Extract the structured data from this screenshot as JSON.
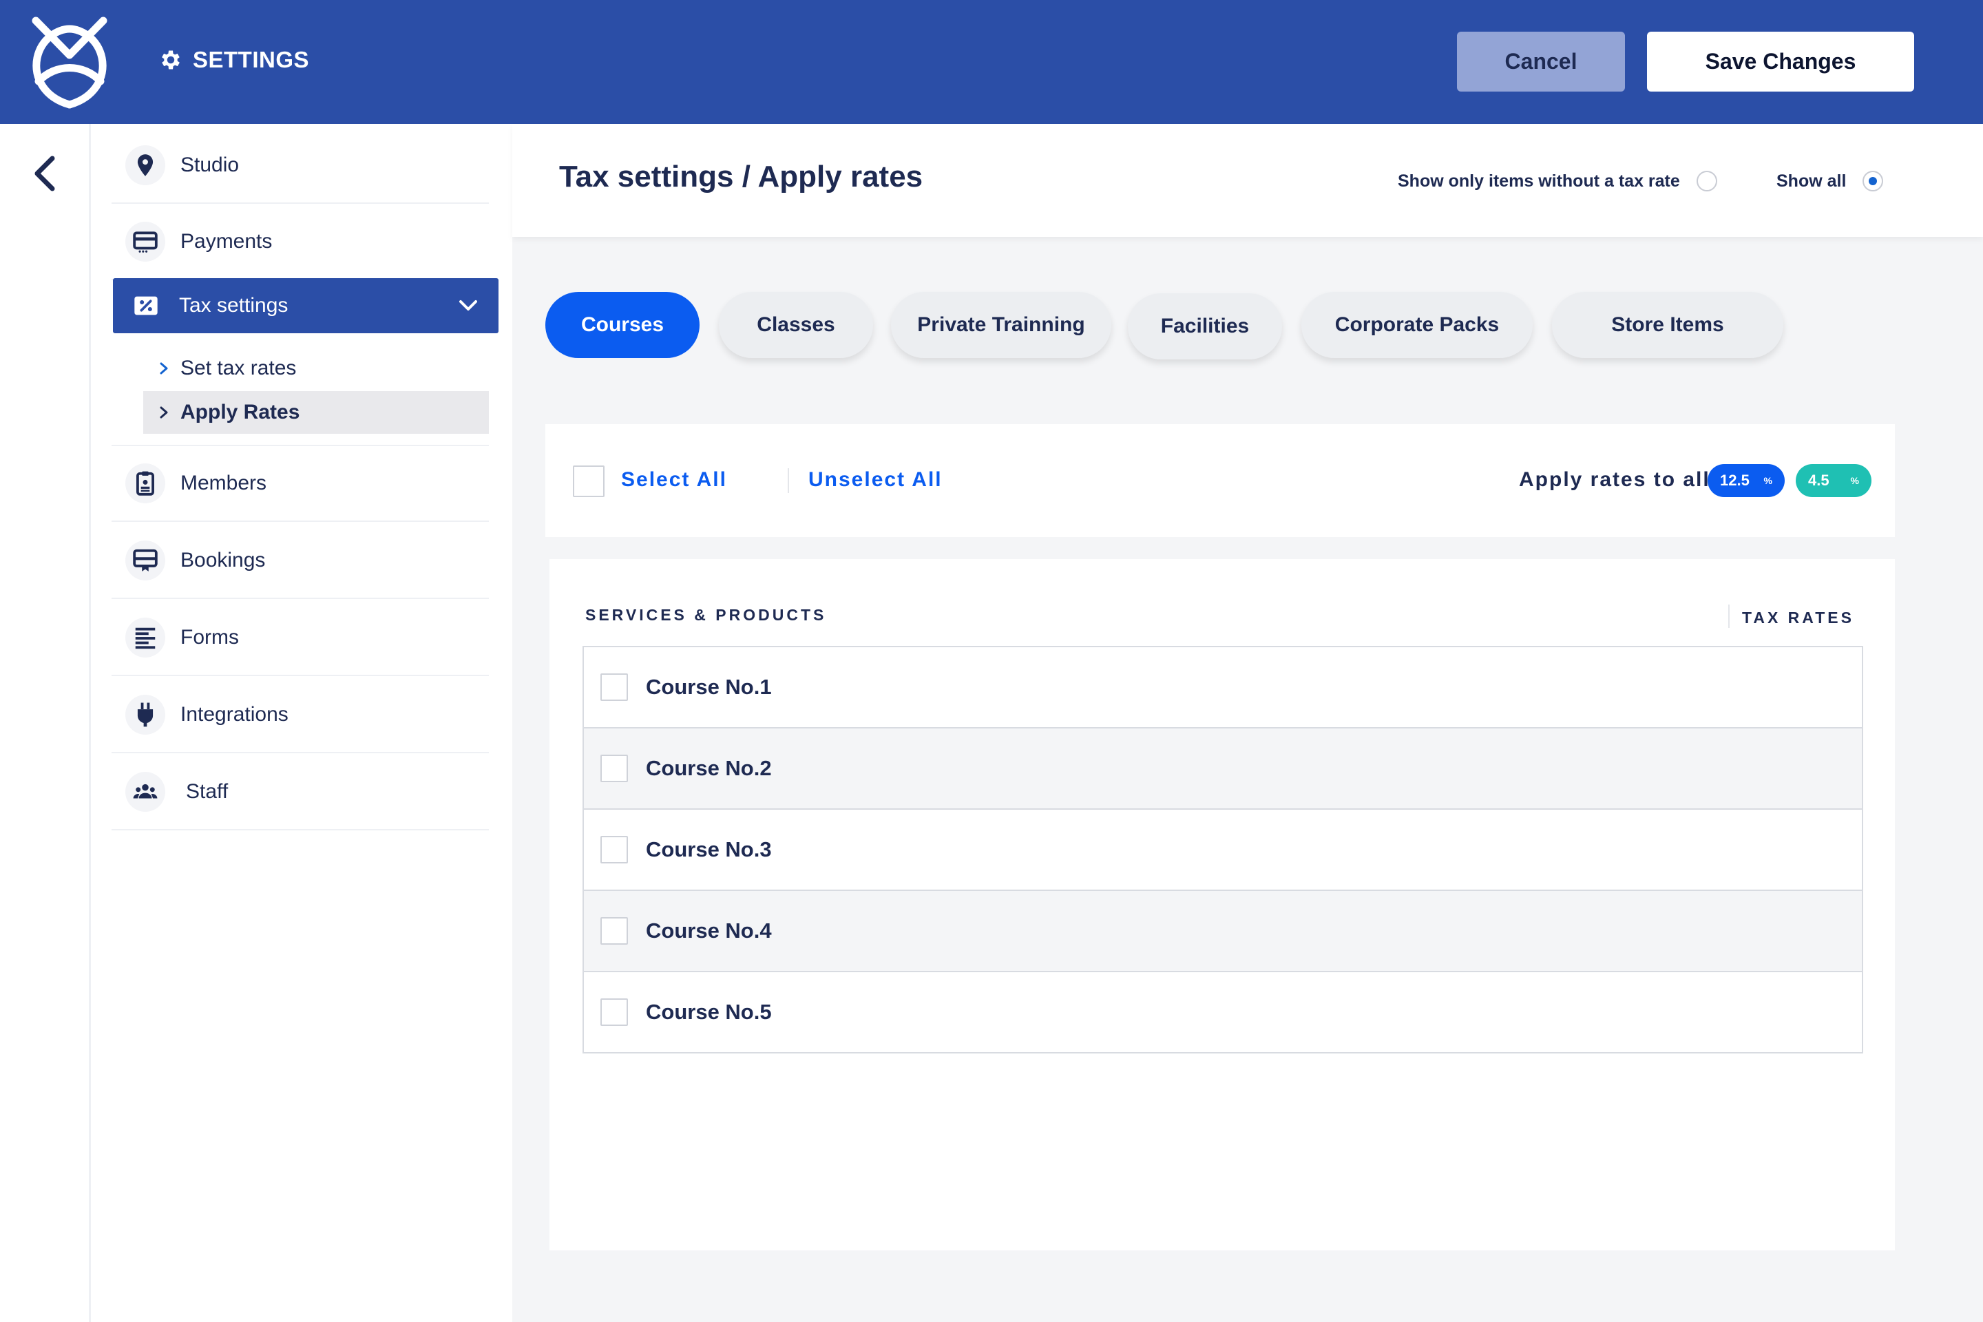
{
  "header": {
    "title": "SETTINGS",
    "cancel_label": "Cancel",
    "save_label": "Save Changes",
    "brand_color": "#2b4ea7"
  },
  "sidebar": {
    "items": [
      {
        "label": "Studio",
        "icon": "map-pin-icon"
      },
      {
        "label": "Payments",
        "icon": "credit-card-icon"
      },
      {
        "label": "Tax settings",
        "icon": "percent-tag-icon",
        "expanded": true
      },
      {
        "label": "Members",
        "icon": "id-badge-icon"
      },
      {
        "label": "Bookings",
        "icon": "booking-icon"
      },
      {
        "label": "Forms",
        "icon": "text-lines-icon"
      },
      {
        "label": "Integrations",
        "icon": "plug-icon"
      },
      {
        "label": "Staff",
        "icon": "people-icon"
      }
    ],
    "sub_items": [
      {
        "label": "Set tax rates",
        "selected": false
      },
      {
        "label": "Apply Rates",
        "selected": true
      }
    ]
  },
  "main": {
    "page_title": "Tax settings / Apply rates",
    "filter_without_rate": "Show only items without a tax rate",
    "filter_show_all": "Show all",
    "filter_selected": "show_all",
    "tabs": [
      {
        "label": "Courses",
        "active": true
      },
      {
        "label": "Classes",
        "active": false
      },
      {
        "label": "Private Trainning",
        "active": false
      },
      {
        "label": "Facilities",
        "active": false
      },
      {
        "label": "Corporate Packs",
        "active": false
      },
      {
        "label": "Store Items",
        "active": false
      }
    ],
    "select_all_label": "Select All",
    "unselect_all_label": "Unselect All",
    "apply_rates_label": "Apply rates to all",
    "rate_pills": [
      {
        "value": "12.5",
        "unit": "%",
        "color": "#0b5cf0"
      },
      {
        "value": "4.5",
        "unit": "%",
        "color": "#1fc0b3"
      }
    ],
    "column_services": "SERVICES & PRODUCTS",
    "column_tax_rates": "TAX RATES",
    "rows": [
      {
        "label": "Course No.1",
        "checked": false
      },
      {
        "label": "Course No.2",
        "checked": false
      },
      {
        "label": "Course No.3",
        "checked": false
      },
      {
        "label": "Course No.4",
        "checked": false
      },
      {
        "label": "Course No.5",
        "checked": false
      }
    ]
  }
}
